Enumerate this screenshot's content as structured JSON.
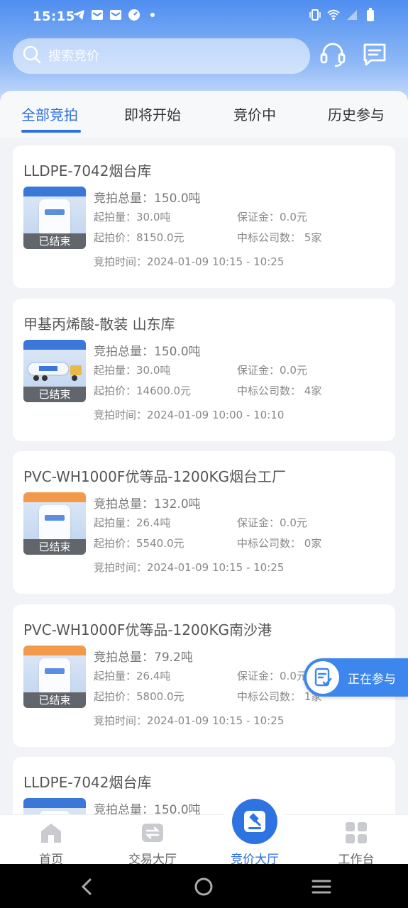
{
  "status_bar": {
    "time": "15:15"
  },
  "search": {
    "placeholder": "搜索竞价"
  },
  "tabs": [
    {
      "label": "全部竞拍",
      "active": true
    },
    {
      "label": "即将开始",
      "active": false
    },
    {
      "label": "竞价中",
      "active": false
    },
    {
      "label": "历史参与",
      "active": false
    }
  ],
  "labels": {
    "total": "竞拍总量：",
    "min_qty": "起拍量：",
    "deposit": "保证金：",
    "start_price": "起拍价：",
    "winners": "中标公司数：",
    "time": "竞拍时间："
  },
  "cards": [
    {
      "title": "LLDPE-7042烟台库",
      "status": "已结束",
      "total": "150.0吨",
      "min_qty": "30.0吨",
      "deposit": "0.0元",
      "start_price": "8150.0元",
      "winners": "5家",
      "time": "2024-01-09 10:15 - 10:25"
    },
    {
      "title": "甲基丙烯酸-散装 山东库",
      "status": "已结束",
      "total": "150.0吨",
      "min_qty": "30.0吨",
      "deposit": "0.0元",
      "start_price": "14600.0元",
      "winners": "4家",
      "time": "2024-01-09 10:00 - 10:10"
    },
    {
      "title": "PVC-WH1000F优等品-1200KG烟台工厂",
      "status": "已结束",
      "total": "132.0吨",
      "min_qty": "26.4吨",
      "deposit": "0.0元",
      "start_price": "5540.0元",
      "winners": "0家",
      "time": "2024-01-09 10:15 - 10:25"
    },
    {
      "title": "PVC-WH1000F优等品-1200KG南沙港",
      "status": "已结束",
      "total": "79.2吨",
      "min_qty": "26.4吨",
      "deposit": "0.0元",
      "start_price": "5800.0元",
      "winners": "1家",
      "time": "2024-01-09 10:15 - 10:25"
    },
    {
      "title": "LLDPE-7042烟台库",
      "status": "",
      "total": "150.0吨"
    }
  ],
  "float_button": {
    "label": "正在参与"
  },
  "nav": [
    {
      "label": "首页"
    },
    {
      "label": "交易大厅"
    },
    {
      "label": "竞价大厅"
    },
    {
      "label": "工作台"
    }
  ],
  "colors": {
    "accent": "#2e6fe0",
    "status_overlay": "#464646"
  }
}
